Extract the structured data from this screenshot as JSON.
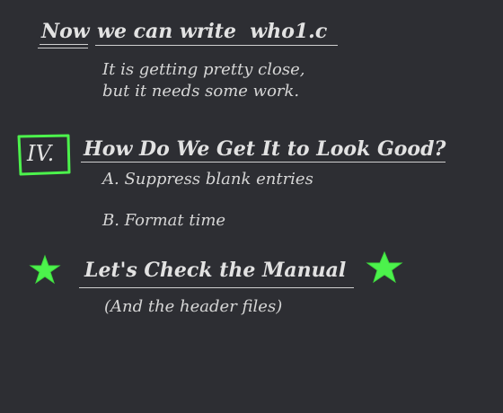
{
  "slide": {
    "title_now": "Now",
    "title_rest": "we can write  who1.c",
    "intro_line1": "It is getting pretty close,",
    "intro_line2": "but it needs some work.",
    "section_numeral": "IV.",
    "section_heading": "How Do We Get It to Look Good?",
    "item_a": "A. Suppress blank entries",
    "item_b": "B. Format time",
    "manual_heading": "Let's Check the Manual",
    "manual_note": "(And the header files)"
  },
  "colors": {
    "background": "#2d2e33",
    "chalk": "#dcdcdc",
    "accent_green": "#4cf24c"
  }
}
